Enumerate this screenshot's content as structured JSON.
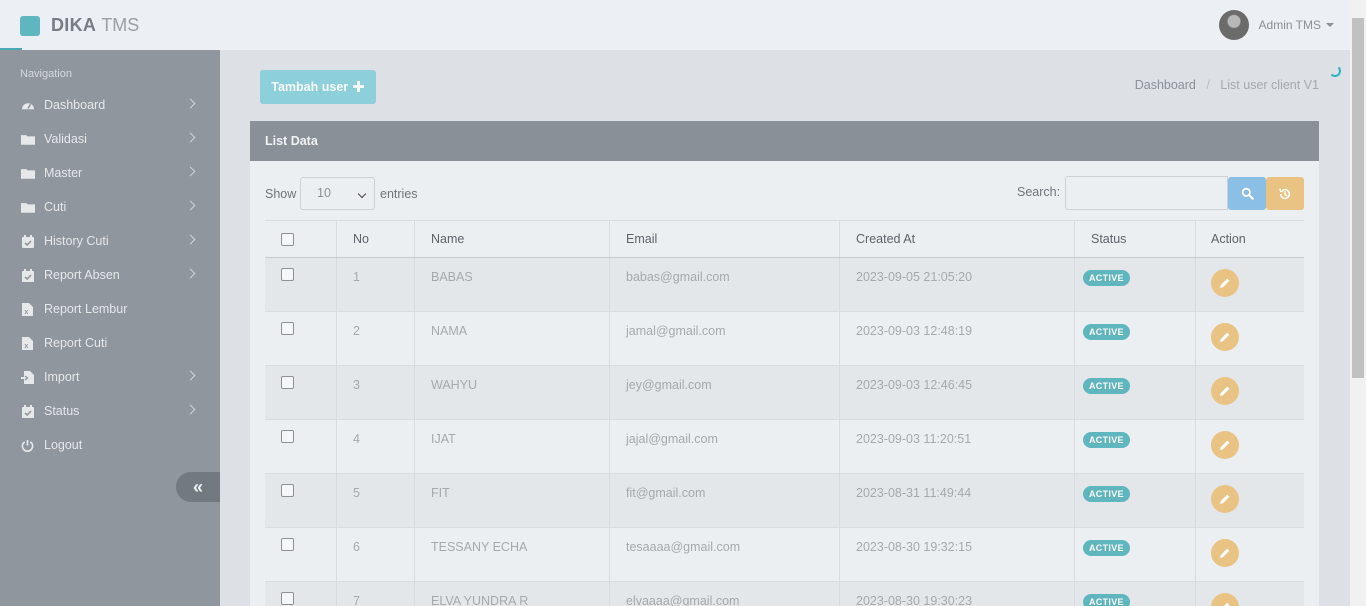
{
  "header": {
    "brand_bold": "DIKA",
    "brand_light": "TMS",
    "user_name": "Admin TMS"
  },
  "sidebar": {
    "heading": "Navigation",
    "items": [
      {
        "label": "Dashboard",
        "icon": "dashboard-icon",
        "has_submenu": true
      },
      {
        "label": "Validasi",
        "icon": "folder-icon",
        "has_submenu": true
      },
      {
        "label": "Master",
        "icon": "folder-icon",
        "has_submenu": true
      },
      {
        "label": "Cuti",
        "icon": "folder-icon",
        "has_submenu": true
      },
      {
        "label": "History Cuti",
        "icon": "calendar-check-icon",
        "has_submenu": true
      },
      {
        "label": "Report Absen",
        "icon": "calendar-check-icon",
        "has_submenu": true
      },
      {
        "label": "Report Lembur",
        "icon": "excel-file-icon",
        "has_submenu": false
      },
      {
        "label": "Report Cuti",
        "icon": "excel-file-icon",
        "has_submenu": false
      },
      {
        "label": "Import",
        "icon": "file-import-icon",
        "has_submenu": true
      },
      {
        "label": "Status",
        "icon": "calendar-check-icon",
        "has_submenu": true
      },
      {
        "label": "Logout",
        "icon": "power-icon",
        "has_submenu": false
      }
    ]
  },
  "toolbar": {
    "add_user_label": "Tambah user"
  },
  "breadcrumb": {
    "home": "Dashboard",
    "separator": "/",
    "current": "List user client V1"
  },
  "panel": {
    "title": "List Data",
    "show_label": "Show",
    "entries_value": "10",
    "entries_label": "entries",
    "search_label": "Search:",
    "search_value": ""
  },
  "table": {
    "columns": [
      "No",
      "Name",
      "Email",
      "Created At",
      "Status",
      "Action"
    ],
    "rows": [
      {
        "no": "1",
        "name": "BABAS",
        "email": "babas@gmail.com",
        "created_at": "2023-09-05 21:05:20",
        "status": "ACTIVE"
      },
      {
        "no": "2",
        "name": "NAMA",
        "email": "jamal@gmail.com",
        "created_at": "2023-09-03 12:48:19",
        "status": "ACTIVE"
      },
      {
        "no": "3",
        "name": "WAHYU",
        "email": "jey@gmail.com",
        "created_at": "2023-09-03 12:46:45",
        "status": "ACTIVE"
      },
      {
        "no": "4",
        "name": "IJAT",
        "email": "jajal@gmail.com",
        "created_at": "2023-09-03 11:20:51",
        "status": "ACTIVE"
      },
      {
        "no": "5",
        "name": "FIT",
        "email": "fit@gmail.com",
        "created_at": "2023-08-31 11:49:44",
        "status": "ACTIVE"
      },
      {
        "no": "6",
        "name": "TESSANY ECHA",
        "email": "tesaaaa@gmail.com",
        "created_at": "2023-08-30 19:32:15",
        "status": "ACTIVE"
      },
      {
        "no": "7",
        "name": "ELVA YUNDRA R",
        "email": "elvaaaa@gmail.com",
        "created_at": "2023-08-30 19:30:23",
        "status": "ACTIVE"
      }
    ]
  },
  "colors": {
    "sidebar_bg": "#8f969e",
    "accent_teal": "#5fb6be",
    "button_primary": "#8ecfdc",
    "button_warning": "#e8c383",
    "button_search": "#8bbfe6"
  }
}
